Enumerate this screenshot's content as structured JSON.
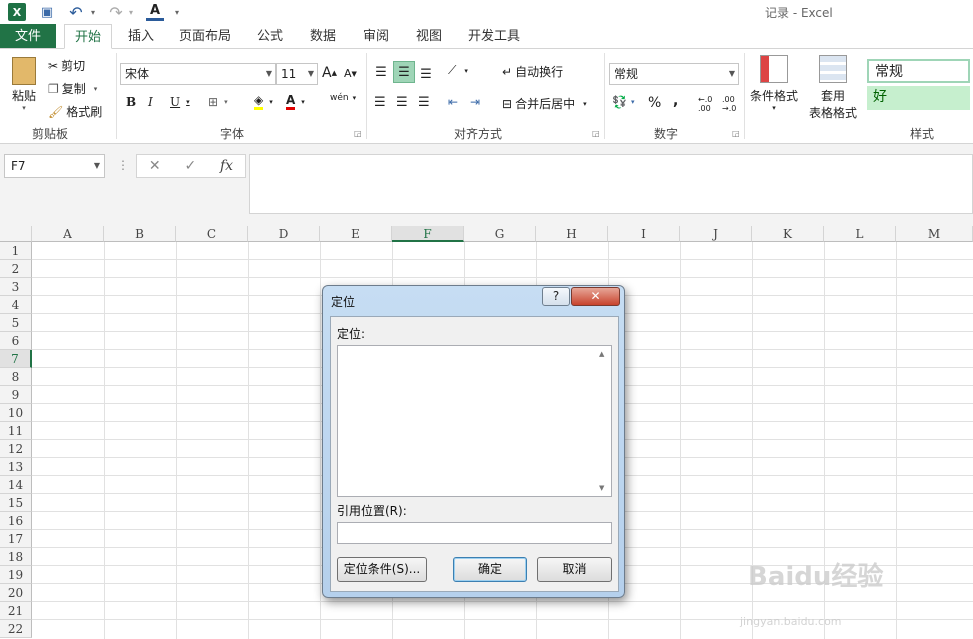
{
  "window": {
    "title": "记录 - Excel"
  },
  "quick_access": {
    "app_icon": "excel-logo-icon",
    "items": [
      {
        "name": "save-icon",
        "glyph": "💾"
      },
      {
        "name": "undo-icon",
        "glyph": "↶"
      },
      {
        "name": "redo-icon",
        "glyph": "↷"
      },
      {
        "name": "font-color-icon",
        "glyph": "A"
      },
      {
        "name": "customize-icon",
        "glyph": "▾"
      }
    ]
  },
  "tabs": [
    "文件",
    "开始",
    "插入",
    "页面布局",
    "公式",
    "数据",
    "审阅",
    "视图",
    "开发工具"
  ],
  "ribbon": {
    "clipboard": {
      "paste": "粘贴",
      "cut": "剪切",
      "copy": "复制",
      "format_painter": "格式刷",
      "label": "剪贴板"
    },
    "font": {
      "name": "宋体",
      "size": "11",
      "grow": "A",
      "shrink": "A",
      "bold": "B",
      "italic": "I",
      "underline": "U",
      "phonetic": "wén",
      "label": "字体"
    },
    "alignment": {
      "wrap": "自动换行",
      "merge": "合并后居中",
      "label": "对齐方式"
    },
    "number": {
      "format": "常规",
      "percent": "%",
      "comma": ",",
      "inc": "←.0 .00",
      "dec": ".00 →.0",
      "label": "数字"
    },
    "styles": {
      "conditional": "条件格式",
      "table_line1": "套用",
      "table_line2": "表格格式",
      "normal": "常规",
      "good": "好",
      "label": "样式"
    }
  },
  "formula_bar": {
    "name_box": "F7",
    "cancel": "✕",
    "enter": "✓",
    "fx": "fx"
  },
  "grid": {
    "columns": [
      "A",
      "B",
      "C",
      "D",
      "E",
      "F",
      "G",
      "H",
      "I",
      "J",
      "K",
      "L",
      "M"
    ],
    "rows": [
      "1",
      "2",
      "3",
      "4",
      "5",
      "6",
      "7",
      "8",
      "9",
      "10",
      "11",
      "12",
      "13",
      "14",
      "15",
      "16",
      "17",
      "18",
      "19",
      "20",
      "21",
      "22"
    ],
    "selected_column": "F",
    "selected_row": "7"
  },
  "dialog": {
    "title": "定位",
    "help": "?",
    "close": "✕",
    "goto_label": "定位:",
    "reference_label": "引用位置(R):",
    "special_button": "定位条件(S)...",
    "ok_button": "确定",
    "cancel_button": "取消"
  },
  "watermark": {
    "brand": "Baidu经验",
    "url": "jingyan.baidu.com"
  },
  "colors": {
    "accent": "#217346",
    "dialog": "#b9d3ee"
  }
}
